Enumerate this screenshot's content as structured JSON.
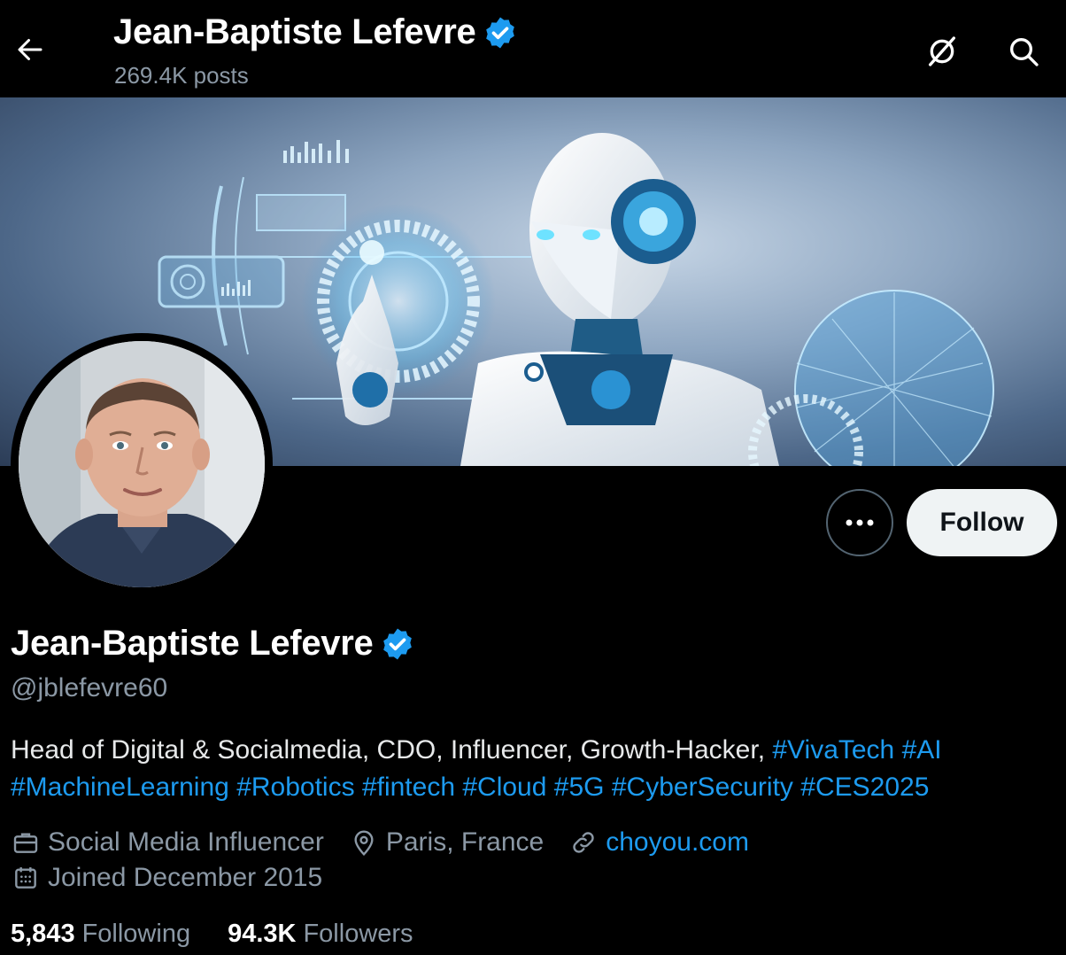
{
  "header": {
    "name": "Jean-Baptiste Lefevre",
    "posts": "269.4K posts"
  },
  "profile": {
    "name": "Jean-Baptiste Lefevre",
    "handle": "@jblefevre60",
    "bio_text": "Head of Digital & Socialmedia, CDO, Influencer, Growth-Hacker,",
    "hashtags_line1": [
      "#VivaTech",
      "#AI"
    ],
    "hashtags_line2": [
      "#MachineLearning",
      "#Robotics",
      "#fintech",
      "#Cloud",
      "#5G",
      "#CyberSecurity",
      "#CES2025"
    ],
    "category": "Social Media Influencer",
    "location": "Paris, France",
    "website": "choyou.com",
    "joined": "Joined December 2015"
  },
  "actions": {
    "follow_label": "Follow"
  },
  "stats": {
    "following_count": "5,843",
    "following_label": "Following",
    "followers_count": "94.3K",
    "followers_label": "Followers"
  },
  "colors": {
    "background": "#000000",
    "accent": "#1d9bf0",
    "secondary_text": "#8b98a5",
    "verified": "#1d9bf0"
  },
  "icons": {
    "back": "arrow-left-icon",
    "grok": "grok-icon",
    "search": "search-icon",
    "verified": "verified-badge-icon",
    "more": "more-dots-icon",
    "category": "briefcase-icon",
    "location": "location-pin-icon",
    "website": "link-icon",
    "joined": "calendar-icon"
  }
}
